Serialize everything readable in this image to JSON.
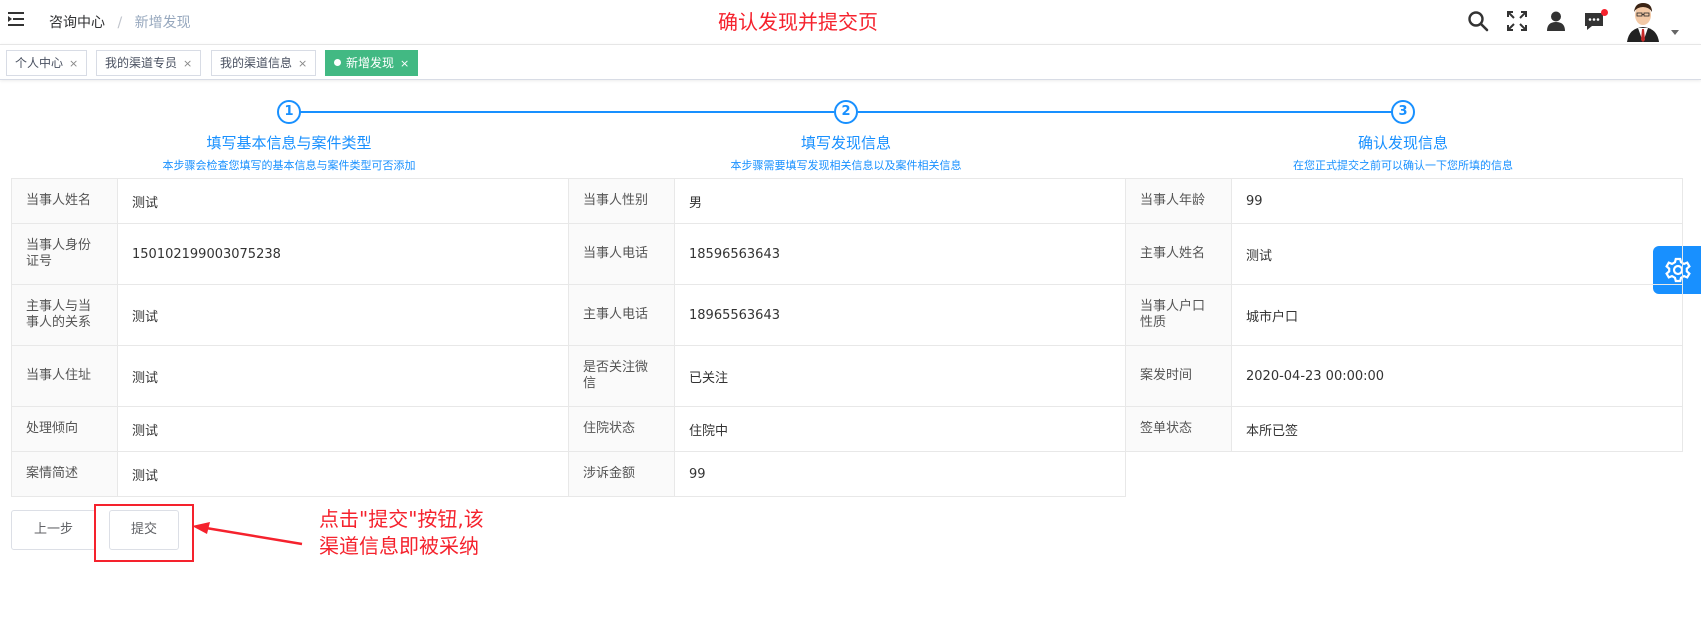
{
  "header": {
    "breadcrumb": [
      "咨询中心",
      "新增发现"
    ],
    "separator": "/",
    "page_caption": "确认发现并提交页",
    "icons": [
      "menu-icon",
      "search-icon",
      "fullscreen-icon",
      "user-icon",
      "message-icon",
      "avatar"
    ]
  },
  "tags": [
    {
      "label": "个人中心",
      "close": "×",
      "active": false
    },
    {
      "label": "我的渠道专员",
      "close": "×",
      "active": false
    },
    {
      "label": "我的渠道信息",
      "close": "×",
      "active": false
    },
    {
      "label": "新增发现",
      "close": "×",
      "active": true
    }
  ],
  "steps": [
    {
      "number": "1",
      "title": "填写基本信息与案件类型",
      "desc": "本步骤会检查您填写的基本信息与案件类型可否添加"
    },
    {
      "number": "2",
      "title": "填写发现信息",
      "desc": "本步骤需要填写发现相关信息以及案件相关信息"
    },
    {
      "number": "3",
      "title": "确认发现信息",
      "desc": "在您正式提交之前可以确认一下您所填的信息"
    }
  ],
  "table": {
    "rows": [
      [
        {
          "label": "当事人姓名",
          "value": "测试"
        },
        {
          "label": "当事人性别",
          "value": "男"
        },
        {
          "label": "当事人年龄",
          "value": "99"
        }
      ],
      [
        {
          "label": "当事人身份证号",
          "value": "150102199003075238"
        },
        {
          "label": "当事人电话",
          "value": "18596563643"
        },
        {
          "label": "主事人姓名",
          "value": "测试"
        }
      ],
      [
        {
          "label": "主事人与当事人的关系",
          "value": "测试"
        },
        {
          "label": "主事人电话",
          "value": "18965563643"
        },
        {
          "label": "当事人户口性质",
          "value": "城市户口"
        }
      ],
      [
        {
          "label": "当事人住址",
          "value": "测试"
        },
        {
          "label": "是否关注微信",
          "value": "已关注"
        },
        {
          "label": "案发时间",
          "value": "2020-04-23 00:00:00"
        }
      ],
      [
        {
          "label": "处理倾向",
          "value": "测试"
        },
        {
          "label": "住院状态",
          "value": "住院中"
        },
        {
          "label": "签单状态",
          "value": "本所已签"
        }
      ],
      [
        {
          "label": "案情简述",
          "value": "测试"
        },
        {
          "label": "涉诉金额",
          "value": "99"
        }
      ]
    ]
  },
  "buttons": {
    "prev": "上一步",
    "submit": "提交"
  },
  "annotation": "点击\"提交\"按钮,该渠道信息即被采纳",
  "colors": {
    "primary": "#1890ff",
    "tag_active": "#42b983",
    "annotation_red": "#f5222d"
  }
}
